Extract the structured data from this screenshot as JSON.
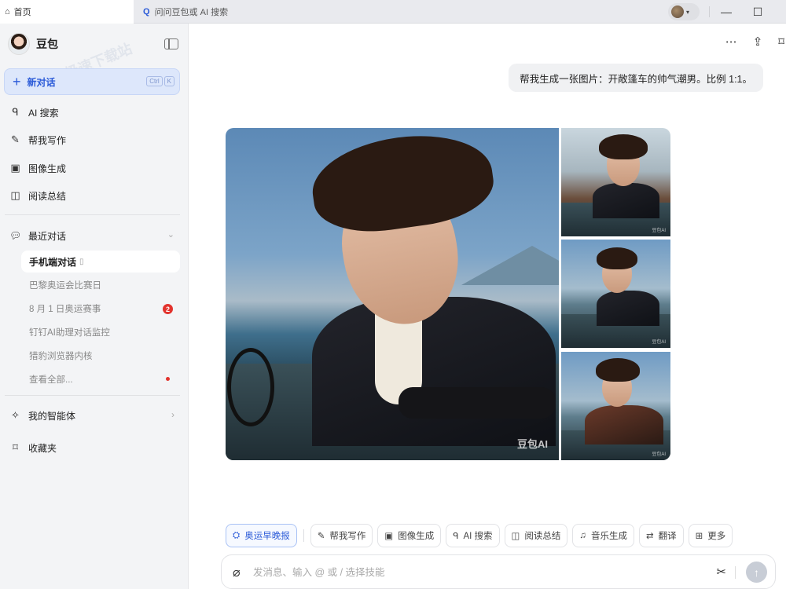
{
  "tabs": [
    {
      "label": "首页",
      "icon": "home-icon"
    },
    {
      "label": "问问豆包或 AI 搜索",
      "icon": "search-icon"
    }
  ],
  "window_controls": [
    "minimize",
    "maximize"
  ],
  "sidebar": {
    "brand": "豆包",
    "new_chat": {
      "label": "新对话",
      "shortcut": [
        "Ctrl",
        "K"
      ]
    },
    "nav": [
      {
        "label": "AI 搜索",
        "icon": "ai-search-icon"
      },
      {
        "label": "帮我写作",
        "icon": "write-icon"
      },
      {
        "label": "图像生成",
        "icon": "image-gen-icon"
      },
      {
        "label": "阅读总结",
        "icon": "read-summary-icon"
      }
    ],
    "recent": {
      "title": "最近对话",
      "items": [
        {
          "label": "手机端对话",
          "active": true
        },
        {
          "label": "巴黎奥运会比赛日"
        },
        {
          "label": "8 月 1 日奥运赛事",
          "badge": "2"
        },
        {
          "label": "钉钉AI助理对话监控"
        },
        {
          "label": "猎豹浏览器内核"
        },
        {
          "label": "查看全部..."
        }
      ]
    },
    "agents": "我的智能体",
    "favorites": "收藏夹",
    "watermark": "极速下载站"
  },
  "conversation": {
    "user_message": "帮我生成一张图片：开敞篷车的帅气潮男。比例 1:1。",
    "image_watermark": "豆包AI",
    "image_watermark_small": "豆包AI"
  },
  "skills": [
    {
      "label": "奥运早晚报",
      "icon": "olympic-icon",
      "active": true
    },
    {
      "label": "帮我写作",
      "icon": "write-icon"
    },
    {
      "label": "图像生成",
      "icon": "image-gen-icon"
    },
    {
      "label": "AI 搜索",
      "icon": "ai-search-icon"
    },
    {
      "label": "阅读总结",
      "icon": "read-summary-icon"
    },
    {
      "label": "音乐生成",
      "icon": "music-icon"
    },
    {
      "label": "翻译",
      "icon": "translate-icon"
    },
    {
      "label": "更多",
      "icon": "more-grid-icon"
    }
  ],
  "input": {
    "placeholder": "发消息、输入 @ 或 / 选择技能"
  },
  "colors": {
    "accent": "#2a5ad8",
    "sidebar_bg": "#f3f4f6",
    "badge": "#e2332d"
  }
}
